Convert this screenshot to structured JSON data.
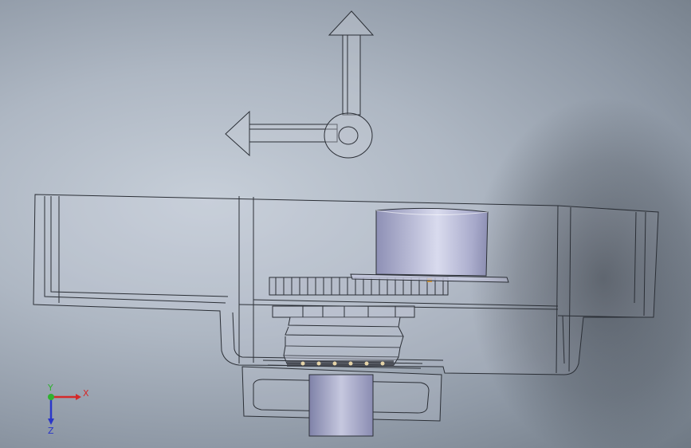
{
  "viewport": {
    "background_top": "#c7cfd9",
    "background_bottom": "#6f7984",
    "edge_color": "#2b2f36",
    "body_fill": "rgba(210,215,225,0.25)",
    "part_fill": "#c7c9e0",
    "part_shade": "#8e90b5",
    "accent": "#e2a13a"
  },
  "triad": {
    "x_label": "X",
    "y_label": "Y",
    "z_label": "Z",
    "x_color": "#d42a2a",
    "y_color": "#2fb12f",
    "z_color": "#2a36c9"
  },
  "icons": {
    "direction_arrow": "move-arrow-icon",
    "rotation_handle": "rotate-handle-icon"
  }
}
